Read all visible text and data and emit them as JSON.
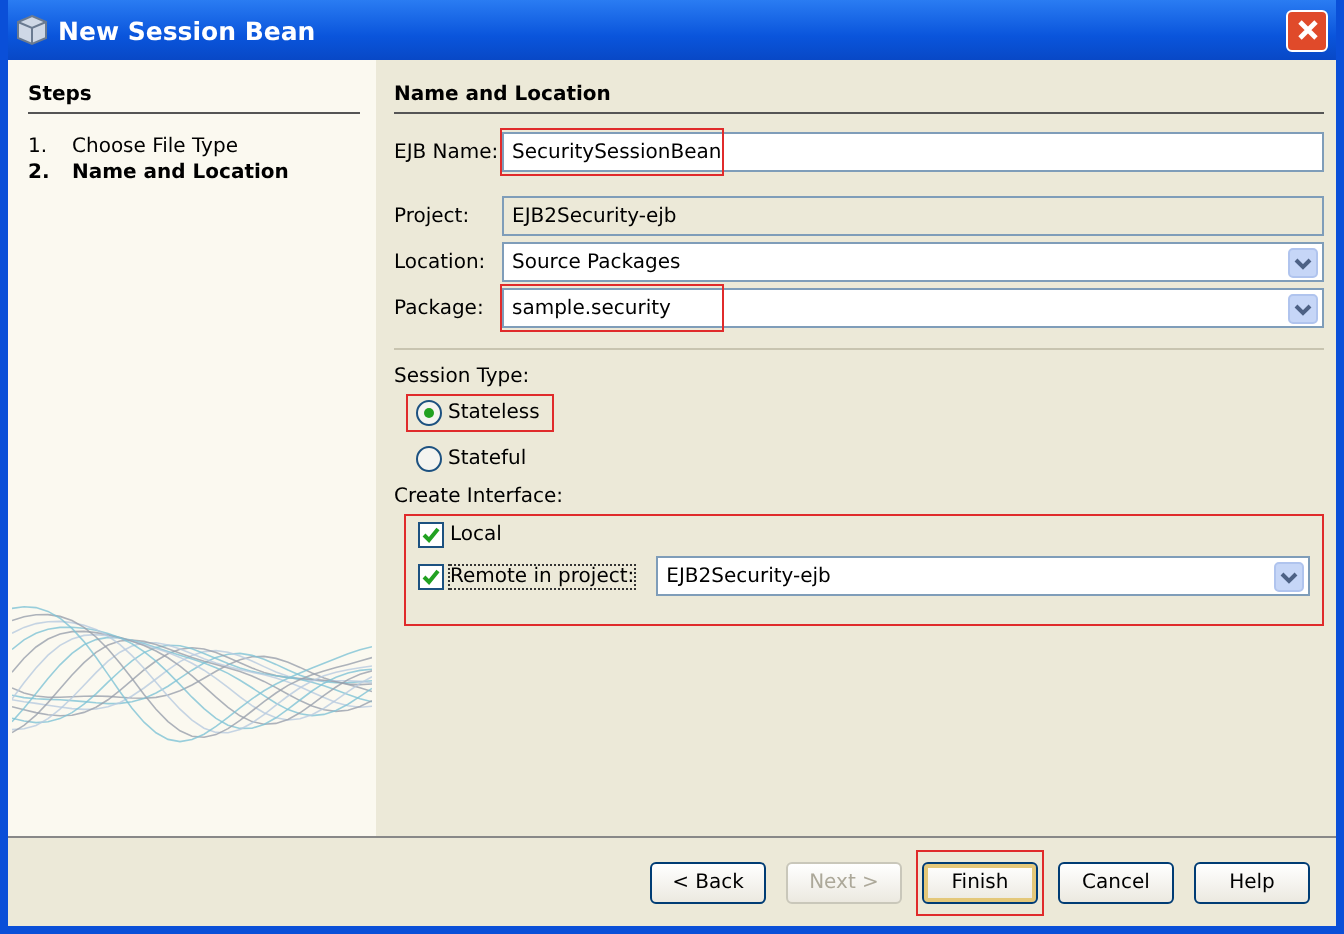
{
  "window": {
    "title": "New Session Bean"
  },
  "steps": {
    "heading": "Steps",
    "items": [
      {
        "number": "1.",
        "label": "Choose File Type",
        "selected": false
      },
      {
        "number": "2.",
        "label": "Name and Location",
        "selected": true
      }
    ]
  },
  "panel": {
    "heading": "Name and Location"
  },
  "fields": [
    {
      "kind": "text",
      "label": "EJB Name:",
      "value": "SecuritySessionBean",
      "highlighted": true
    },
    {
      "kind": "readonly",
      "label": "Project:",
      "value": "EJB2Security-ejb",
      "highlighted": false
    },
    {
      "kind": "dropdown",
      "label": "Location:",
      "value": "Source Packages",
      "highlighted": false
    },
    {
      "kind": "dropdown",
      "label": "Package:",
      "value": "sample.security",
      "highlighted": true
    }
  ],
  "session_type": {
    "label": "Session Type:",
    "options": [
      {
        "label": "Stateless",
        "selected": true,
        "highlighted": true
      },
      {
        "label": "Stateful",
        "selected": false,
        "highlighted": false
      }
    ]
  },
  "create_interface": {
    "label": "Create Interface:",
    "highlighted": true,
    "options": [
      {
        "kind": "check",
        "label": "Local",
        "checked": true
      },
      {
        "kind": "check-project",
        "label": "Remote in project:",
        "checked": true,
        "project": "EJB2Security-ejb"
      }
    ]
  },
  "buttons": [
    {
      "label": "< Back",
      "disabled": false,
      "highlighted": false
    },
    {
      "label": "Next >",
      "disabled": true,
      "highlighted": false
    },
    {
      "label": "Finish",
      "disabled": false,
      "highlighted": true
    },
    {
      "label": "Cancel",
      "disabled": false,
      "highlighted": false
    },
    {
      "label": "Help",
      "disabled": false,
      "highlighted": false
    }
  ]
}
